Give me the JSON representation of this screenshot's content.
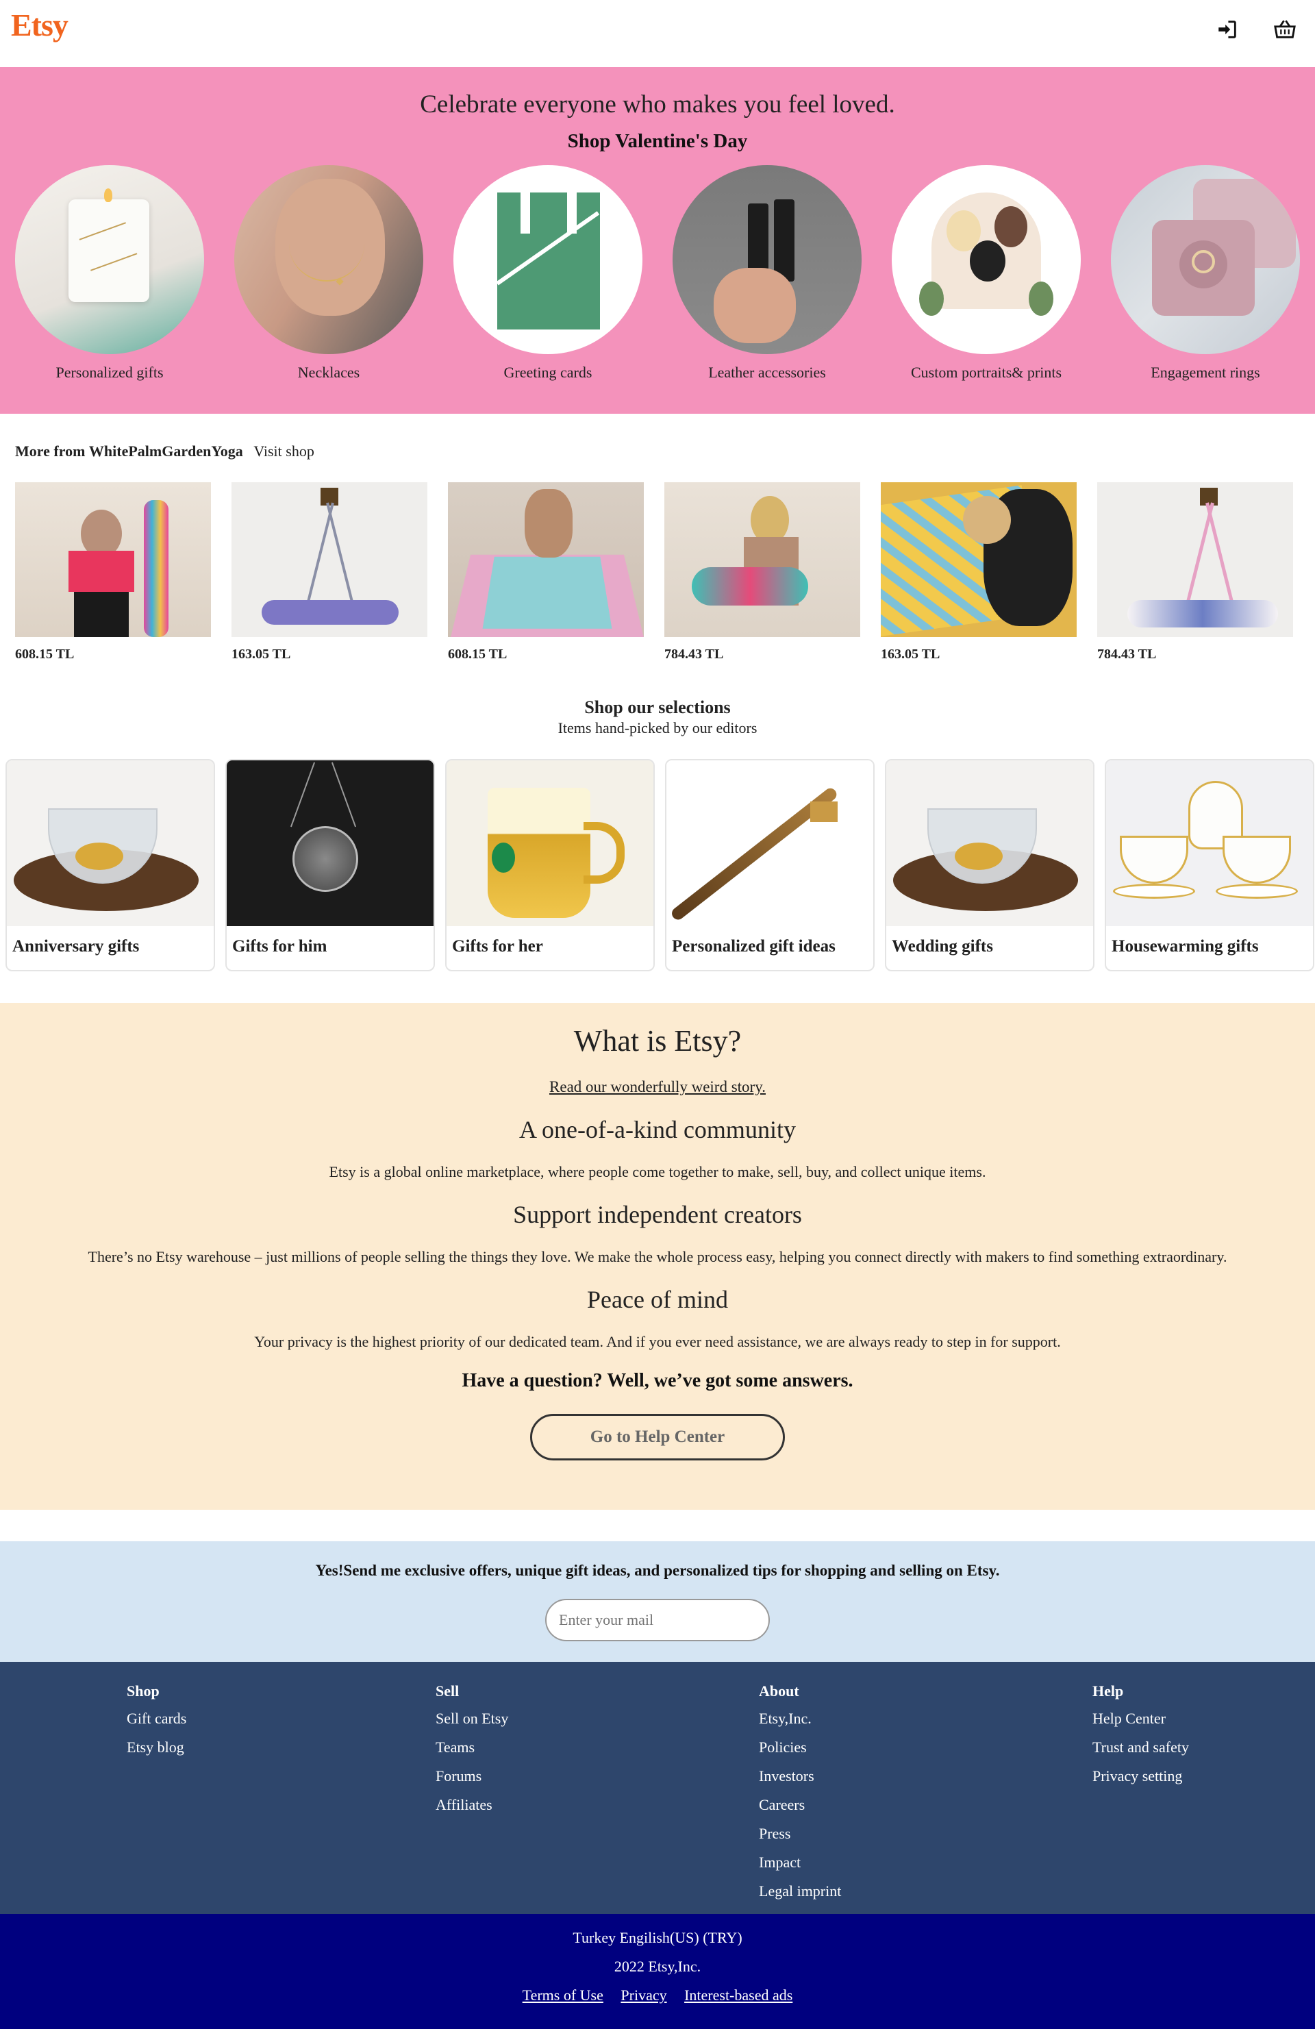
{
  "header": {
    "logo": "Etsy",
    "signin_icon": "sign-in-icon",
    "basket_icon": "basket-icon"
  },
  "valentine": {
    "headline": "Celebrate everyone who makes you feel loved.",
    "subhead": "Shop Valentine's Day",
    "categories": [
      {
        "label": "Personalized gifts"
      },
      {
        "label": "Necklaces"
      },
      {
        "label": "Greeting cards"
      },
      {
        "label": "Leather accessories"
      },
      {
        "label": "Custom portraits& prints"
      },
      {
        "label": "Engagement rings"
      }
    ]
  },
  "more_from": {
    "prefix": "More from",
    "shop": "WhitePalmGardenYoga",
    "visit": "Visit shop",
    "products": [
      {
        "price": "608.15 TL"
      },
      {
        "price": "163.05 TL"
      },
      {
        "price": "608.15 TL"
      },
      {
        "price": "784.43 TL"
      },
      {
        "price": "163.05 TL"
      },
      {
        "price": "784.43 TL"
      }
    ]
  },
  "selections": {
    "title": "Shop our selections",
    "subtitle": "Items hand-picked by our editors",
    "cards": [
      {
        "label": "Anniversary gifts"
      },
      {
        "label": "Gifts for him"
      },
      {
        "label": "Gifts for her"
      },
      {
        "label": "Personalized gift ideas"
      },
      {
        "label": "Wedding gifts"
      },
      {
        "label": "Housewarming gifts"
      }
    ]
  },
  "about": {
    "title": "What is Etsy?",
    "story_link": "Read our wonderfully weird story.",
    "community_title": "A one-of-a-kind community",
    "community_text": "Etsy is a global online marketplace, where people come together to make, sell, buy, and collect unique items.",
    "creators_title": "Support independent creators",
    "creators_text": "There’s no Etsy warehouse – just millions of people selling the things they love. We make the whole process easy, helping you connect directly with makers to find something extraordinary.",
    "peace_title": "Peace of mind",
    "peace_text": "Your privacy is the highest priority of our dedicated team. And if you ever need assistance, we are always ready to step in for support.",
    "question": "Have a question? Well, we’ve got some answers.",
    "help_button": "Go to Help Center"
  },
  "newsletter": {
    "text": "Yes!Send me exclusive offers, unique gift ideas, and personalized tips for shopping and selling on Etsy.",
    "placeholder": "Enter your mail"
  },
  "footer": {
    "shop": {
      "head": "Shop",
      "links": [
        "Gift cards",
        "Etsy blog"
      ]
    },
    "sell": {
      "head": "Sell",
      "links": [
        "Sell on Etsy",
        "Teams",
        "Forums",
        "Affiliates"
      ]
    },
    "about": {
      "head": "About",
      "links": [
        "Etsy,Inc.",
        "Policies",
        "Investors",
        "Careers",
        "Press",
        "Impact",
        "Legal imprint"
      ]
    },
    "help": {
      "head": "Help",
      "links": [
        "Help Center",
        "Trust and safety",
        "Privacy setting"
      ]
    }
  },
  "bottom": {
    "locale": "Turkey Engilish(US) (TRY)",
    "copyright": "2022 Etsy,Inc.",
    "terms": "Terms of Use",
    "privacy": "Privacy",
    "ads": "Interest-based ads"
  }
}
